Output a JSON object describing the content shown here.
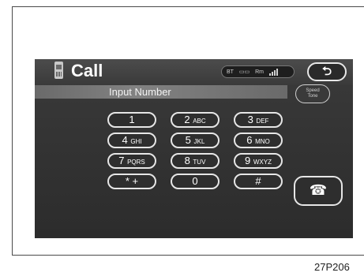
{
  "header": {
    "title": "Call",
    "status": {
      "bt_label": "BT",
      "battery_label": "▭▭",
      "roam_label": "Rm"
    },
    "back_icon": "back-arrow-icon"
  },
  "input": {
    "label": "Input Number",
    "speed_tone": {
      "line1": "Speed",
      "line2": "Tone"
    }
  },
  "keypad": {
    "k1": {
      "num": "1",
      "letters": ""
    },
    "k2": {
      "num": "2",
      "letters": "ABC"
    },
    "k3": {
      "num": "3",
      "letters": "DEF"
    },
    "k4": {
      "num": "4",
      "letters": "GHI"
    },
    "k5": {
      "num": "5",
      "letters": "JKL"
    },
    "k6": {
      "num": "6",
      "letters": "MNO"
    },
    "k7": {
      "num": "7",
      "letters": "PQRS"
    },
    "k8": {
      "num": "8",
      "letters": "TUV"
    },
    "k9": {
      "num": "9",
      "letters": "WXYZ"
    },
    "kstar": {
      "num": "*  +",
      "letters": ""
    },
    "k0": {
      "num": "0",
      "letters": ""
    },
    "khash": {
      "num": "#",
      "letters": ""
    }
  },
  "call_button": {
    "icon": "handset-icon",
    "glyph": "☎"
  },
  "reference_code": "27P206"
}
